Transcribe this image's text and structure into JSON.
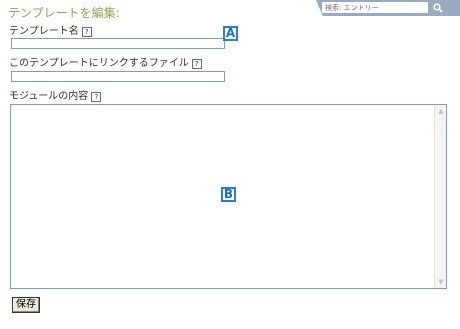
{
  "header": {
    "title": "テンプレートを編集:",
    "search": {
      "placeholder": "検索: エントリー",
      "button_icon": "search-icon"
    }
  },
  "form": {
    "template_name": {
      "label": "テンプレート名",
      "value": "",
      "help": "?"
    },
    "linked_file": {
      "label": "このテンプレートにリンクするファイル",
      "value": "",
      "help": "?"
    },
    "module_content": {
      "label": "モジュールの内容",
      "value": "",
      "help": "?"
    }
  },
  "markers": {
    "a": "A",
    "b": "B"
  },
  "actions": {
    "save_label": "保存"
  },
  "colors": {
    "title": "#8aa85a",
    "marker": "#2a7fd0",
    "search_tab": "#9aaac0",
    "input_border": "#7f9db9"
  }
}
